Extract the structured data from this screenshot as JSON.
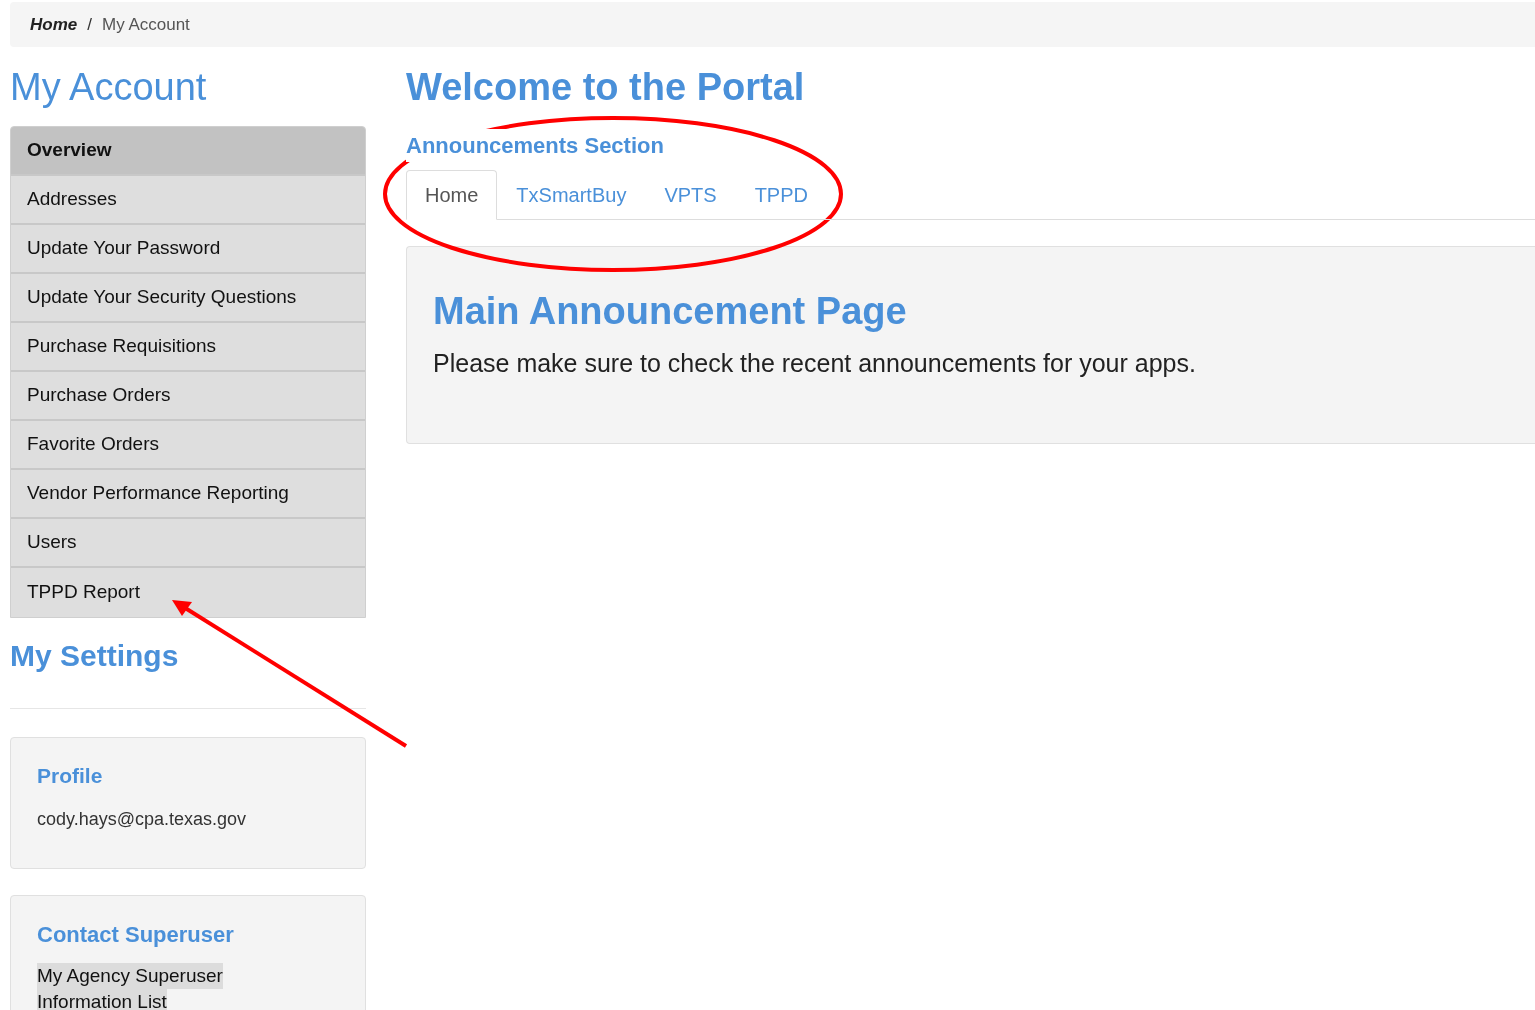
{
  "breadcrumb": [
    {
      "label": "Home",
      "current": false
    },
    {
      "label": "/",
      "kind": "separator"
    },
    {
      "label": "My Account",
      "current": true
    }
  ],
  "sidebar": {
    "title": "My Account",
    "items": [
      {
        "label": "Overview",
        "selected": true
      },
      {
        "label": "Addresses",
        "selected": false
      },
      {
        "label": "Update Your Password",
        "selected": false
      },
      {
        "label": "Update Your Security Questions",
        "selected": false
      },
      {
        "label": "Purchase Requisitions",
        "selected": false
      },
      {
        "label": "Purchase Orders",
        "selected": false
      },
      {
        "label": "Favorite Orders",
        "selected": false
      },
      {
        "label": "Vendor Performance Reporting",
        "selected": false
      },
      {
        "label": "Users",
        "selected": false
      },
      {
        "label": "TPPD Report",
        "selected": false
      }
    ]
  },
  "settings": {
    "title": "My Settings",
    "profile": {
      "title": "Profile",
      "email": "cody.hays@cpa.texas.gov"
    },
    "contact": {
      "title": "Contact Superuser",
      "link_lines": [
        "My Agency Superuser",
        "Information List"
      ]
    }
  },
  "main": {
    "title": "Welcome to the Portal",
    "section_title": "Announcements Section",
    "tabs": [
      {
        "label": "Home",
        "selected": true
      },
      {
        "label": "TxSmartBuy",
        "selected": false
      },
      {
        "label": "VPTS",
        "selected": false
      },
      {
        "label": "TPPD",
        "selected": false
      }
    ],
    "panel": {
      "title": "Main Announcement Page",
      "text": "Please make sure to check the recent announcements for your apps."
    }
  },
  "annotation_ellipse": {
    "color": "#ff0000"
  },
  "annotation_arrow": {
    "color": "#ff0000"
  }
}
